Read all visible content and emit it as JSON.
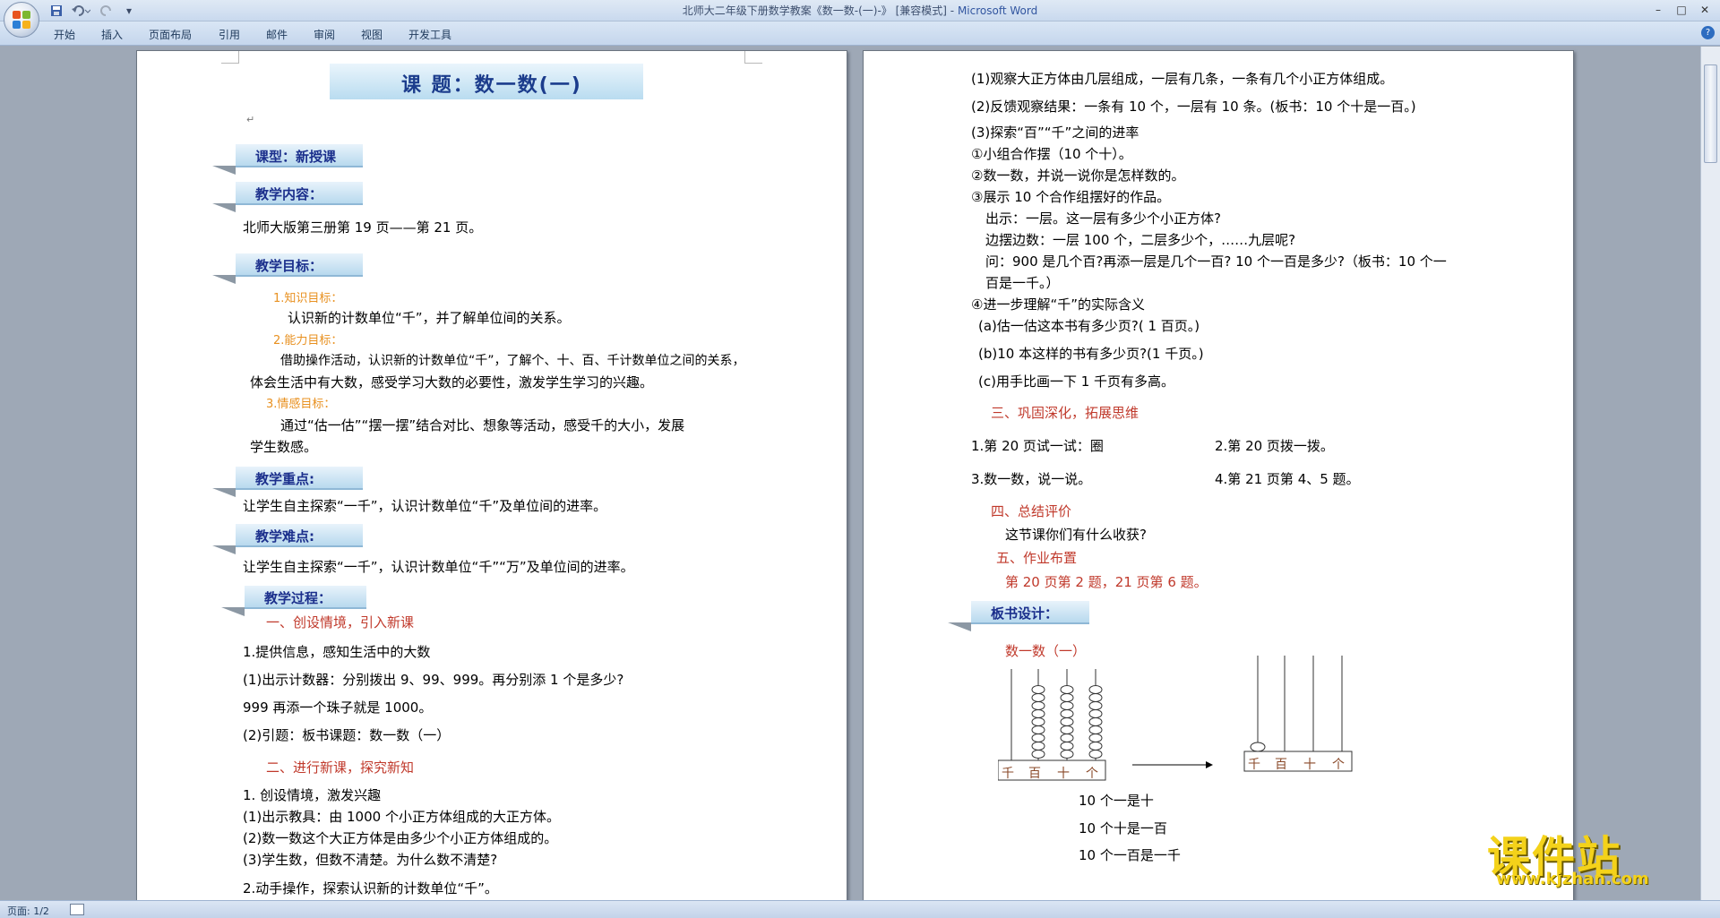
{
  "window": {
    "title_doc": "北师大二年级下册数学教案《数一数-(一)-》 [兼容模式] - ",
    "title_app": "Microsoft Word",
    "minimize": "–",
    "maximize": "□",
    "close": "✕"
  },
  "quick_access": {
    "save_icon": "save-icon",
    "undo_icon": "undo-icon",
    "redo_icon": "redo-icon",
    "more": "▾"
  },
  "ribbon_tabs": [
    "开始",
    "插入",
    "页面布局",
    "引用",
    "邮件",
    "审阅",
    "视图",
    "开发工具"
  ],
  "help_glyph": "?",
  "page1": {
    "title": "课    题：数一数(一)",
    "type_label": "课型：新授课",
    "content_label": "教学内容：",
    "content_text": "北师大版第三册第 19 页——第 21 页。",
    "goals_label": "教学目标：",
    "goal1_label": "1.知识目标：",
    "goal1_text": "认识新的计数单位“千”，并了解单位间的关系。",
    "goal2_label": "2.能力目标：",
    "goal2_text_a": "借助操作活动，认识新的计数单位“千”，了解个、十、百、千计数单位之间的关系，",
    "goal2_text_b": "体会生活中有大数，感受学习大数的必要性，激发学生学习的兴趣。",
    "goal3_label": "3.情感目标：",
    "goal3_text_a": "通过“估一估”“摆一摆”结合对比、想象等活动，感受千的大小，发展",
    "goal3_text_b": "学生数感。",
    "key_label": "教学重点:",
    "key_text": "让学生自主探索“一千”，认识计数单位“千”及单位间的进率。",
    "diff_label": "教学难点:",
    "diff_text": "让学生自主探索“一千”，认识计数单位“千”“万”及单位间的进率。",
    "process_label": "教学过程：",
    "sec1": "一、创设情境，引入新课",
    "p1": "1.提供信息，感知生活中的大数",
    "p2": "(1)出示计数器：分别拨出 9、99、999。再分别添 1 个是多少?",
    "p3": "999 再添一个珠子就是 1000。",
    "p4": "(2)引题：板书课题：数一数（一）",
    "sec2": "二、进行新课，探究新知",
    "p5": "1. 创设情境，激发兴趣",
    "p6": "(1)出示教具：由 1000 个小正方体组成的大正方体。",
    "p7": "(2)数一数这个大正方体是由多少个小正方体组成的。",
    "p8": "(3)学生数，但数不清楚。为什么数不清楚?",
    "p9": "2.动手操作，探索认识新的计数单位“千”。"
  },
  "page2": {
    "l1": "(1)观察大正方体由几层组成，一层有几条，一条有几个小正方体组成。",
    "l2": "(2)反馈观察结果：一条有 10 个，一层有 10 条。(板书：10 个十是一百。)",
    "l3": "(3)探索“百”“千”之间的进率",
    "l4": "①小组合作摆（10 个十）。",
    "l5": "②数一数，并说一说你是怎样数的。",
    "l6": "③展示 10 个合作组摆好的作品。",
    "l7": "出示：一层。这一层有多少个小正方体?",
    "l8": "边摆边数：一层 100 个，二层多少个，……九层呢?",
    "l9": "问：900 是几个百?再添一层是几个一百? 10 个一百是多少?（板书：10 个一",
    "l10": "百是一千。）",
    "l11": "④进一步理解“千”的实际含义",
    "l12": "(a)估一估这本书有多少页?( 1 百页。)",
    "l13": "(b)10 本这样的书有多少页?(1 千页。)",
    "l14": "(c)用手比画一下 1 千页有多高。",
    "sec3": "三、巩固深化，拓展思维",
    "e1": "1.第 20 页试一试：圈",
    "e2": "2.第 20 页拨一拨。",
    "e3": "3.数一数，说一说。",
    "e4": "4.第 21 页第 4、5 题。",
    "sec4": "四、总结评价",
    "s4": "这节课你们有什么收获?",
    "sec5": "五、作业布置",
    "hw": "第 20 页第 2 题，21 页第 6 题。",
    "board_label": "板书设计：",
    "board_title": "数一数（一）",
    "abacus_labels": [
      "千",
      "百",
      "十",
      "个"
    ],
    "b1": "10 个一是十",
    "b2": "10 个十是一百",
    "b3": "10 个一百是一千"
  },
  "status": {
    "page": "页面: 1/2"
  },
  "watermark": {
    "big": "课件站",
    "url": "www.kjzhan.com"
  },
  "return_mark": "↵"
}
